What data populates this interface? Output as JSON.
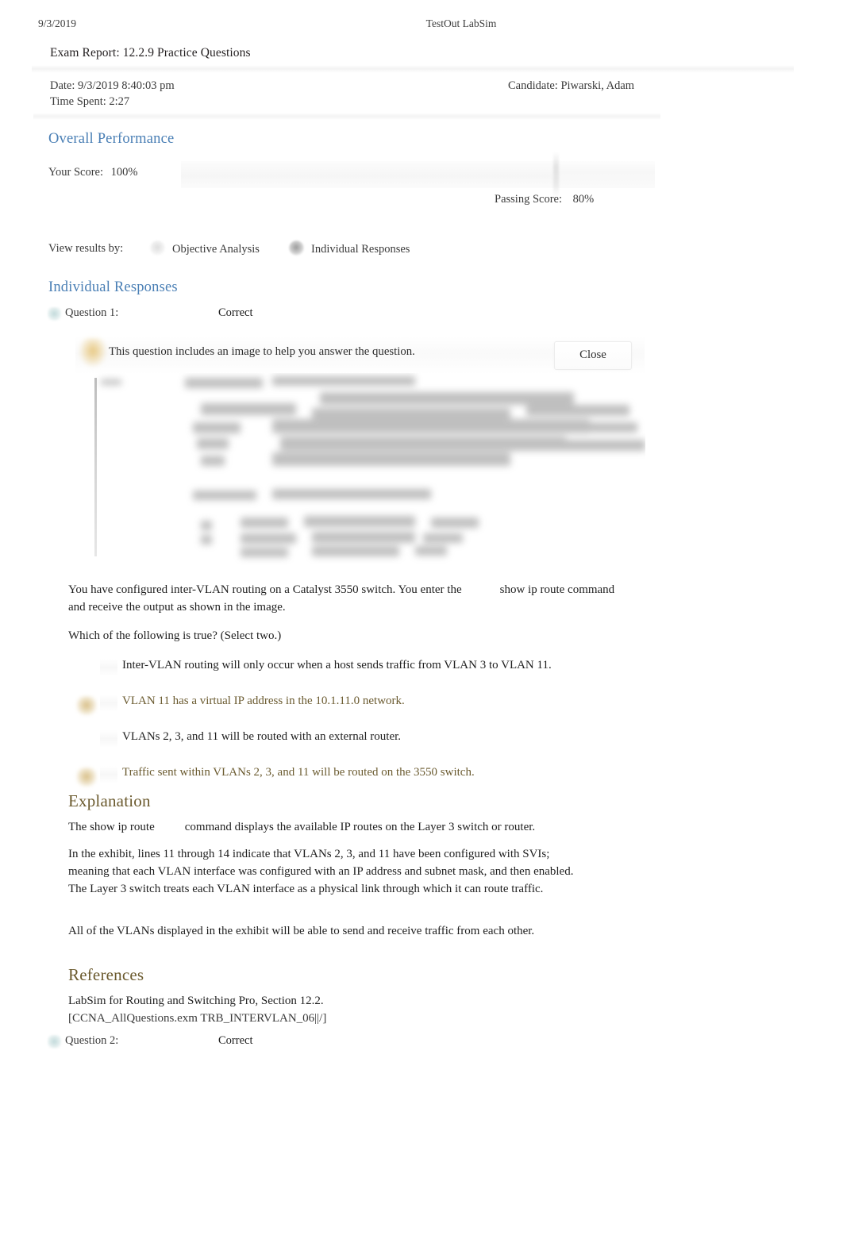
{
  "print_header": {
    "date": "9/3/2019",
    "app_title": "TestOut LabSim"
  },
  "report": {
    "title": "Exam Report: 12.2.9 Practice Questions",
    "date_line": "Date: 9/3/2019 8:40:03 pm",
    "candidate_line": "Candidate: Piwarski, Adam",
    "time_spent_line": "Time Spent: 2:27"
  },
  "overall_performance": {
    "heading": "Overall Performance",
    "your_score_label": "Your Score:",
    "your_score_value": "100%",
    "passing_score_label": "Passing Score:",
    "passing_score_value": "80%",
    "score_percent": 100,
    "passing_percent": 80
  },
  "view_results": {
    "label": "View results by:",
    "options": [
      {
        "label": "Objective Analysis",
        "selected": false
      },
      {
        "label": "Individual Responses",
        "selected": true
      }
    ]
  },
  "individual_responses": {
    "heading": "Individual Responses"
  },
  "questions": [
    {
      "label": "Question 1:",
      "status": "Correct",
      "image_notice": {
        "text": "This question includes an image to help you answer the question.",
        "close_label": "Close"
      },
      "stem_part1": "You have configured inter-VLAN routing on a Catalyst 3550 switch. You enter the",
      "stem_code": "show ip route",
      "stem_part2": "command and receive the output as shown in the image.",
      "prompt": "Which of the following is true? (Select two.)",
      "answers": [
        {
          "text": "Inter-VLAN routing will only occur when a host sends traffic from VLAN 3 to VLAN 11.",
          "correct": false
        },
        {
          "text": "VLAN 11 has a virtual IP address in the 10.1.11.0 network.",
          "correct": true
        },
        {
          "text": "VLANs 2, 3, and 11 will be routed with an external router.",
          "correct": false
        },
        {
          "text": "Traffic sent within VLANs 2, 3, and 11 will be routed on the 3550 switch.",
          "correct": true
        }
      ],
      "explanation": {
        "heading": "Explanation",
        "p1_before": "The",
        "p1_code": "show ip route",
        "p1_after": "command displays the available IP routes on the Layer 3 switch or router.",
        "p2": "In the exhibit, lines 11 through 14 indicate that VLANs 2, 3, and 11 have been configured with SVIs; meaning that each VLAN interface was configured with an IP address and subnet mask, and then enabled. The Layer 3 switch treats each VLAN interface as a physical link through which it can route traffic.",
        "p3": "All of the VLANs displayed in the exhibit will be able to send and receive traffic from each other."
      },
      "references": {
        "heading": "References",
        "line1": "LabSim for Routing and Switching Pro, Section 12.2.",
        "line2": "[CCNA_AllQuestions.exm TRB_INTERVLAN_06||/]"
      }
    },
    {
      "label": "Question 2:",
      "status": "Correct"
    }
  ],
  "colors": {
    "heading_blue": "#4a7fb5",
    "heading_brown": "#6b5a2e",
    "correct_answer_text": "#6b5b30",
    "body_text": "#1f1f1f",
    "muted_text": "#3a3a3a",
    "marker_gold": "#c7a456",
    "question_badge_teal": "#bad5d6"
  }
}
